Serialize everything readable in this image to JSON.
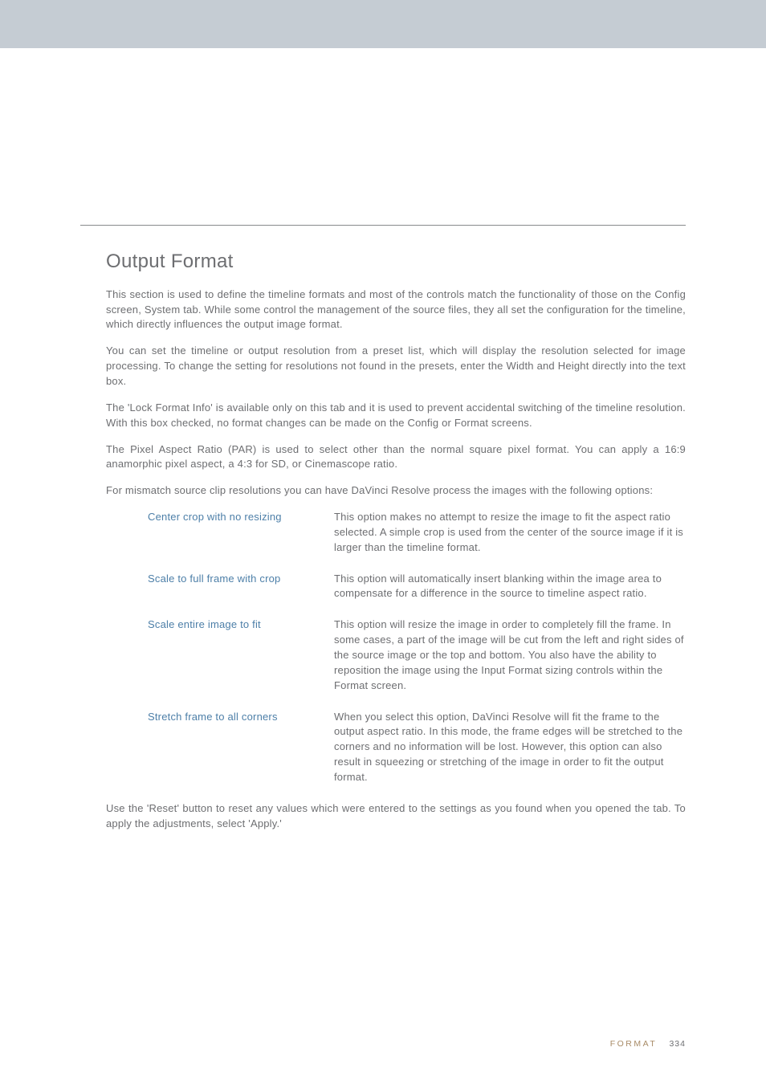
{
  "section": {
    "title": "Output Format",
    "p1": "This section is used to define the timeline formats and most of the controls match the functionality of those on the Config screen, System tab. While some control the management of the source files, they all set the configuration for the timeline, which directly influences the output image format.",
    "p2": "You can set the timeline or output resolution from a preset list, which will display the resolution selected for image processing. To change the setting for resolutions not found in the presets, enter the Width and Height directly into the text box.",
    "p3": "The 'Lock Format Info' is available only on this tab and it is used to prevent accidental switching of the timeline resolution. With this box checked, no format changes can be made on the Config or Format screens.",
    "p4": "The Pixel Aspect Ratio (PAR) is used to select other than the normal square pixel format. You can apply a 16:9 anamorphic pixel aspect, a 4:3 for SD, or Cinemascope ratio.",
    "p5": "For mismatch source clip resolutions you can have DaVinci Resolve process the images with the following options:",
    "options": [
      {
        "term": "Center crop with no resizing",
        "desc": "This option makes no attempt to resize the image to fit the aspect ratio selected. A simple crop is used from the center of the source image if it is larger than the timeline format."
      },
      {
        "term": "Scale to full frame with crop",
        "desc": "This option will automatically insert blanking within the image area to compensate for a difference in the source to timeline aspect ratio."
      },
      {
        "term": "Scale entire image to fit",
        "desc": "This option will resize the image in order to completely fill the frame. In some cases, a part of the image will be cut from the left and right sides of the source image or the top and bottom. You also have the ability to reposition the image using the Input Format sizing controls within the Format screen."
      },
      {
        "term": "Stretch frame to all corners",
        "desc": "When you select this option, DaVinci Resolve will fit the frame to the output aspect ratio. In this mode, the frame edges will be stretched to the corners and no information will be lost. However, this option can also result in squeezing or stretching of the image in order to fit the output format."
      }
    ],
    "p6": "Use the 'Reset' button to reset any values which were entered to the settings as you found when you opened the tab. To apply the adjustments, select 'Apply.'"
  },
  "footer": {
    "label": "FORMAT",
    "page": "334"
  }
}
